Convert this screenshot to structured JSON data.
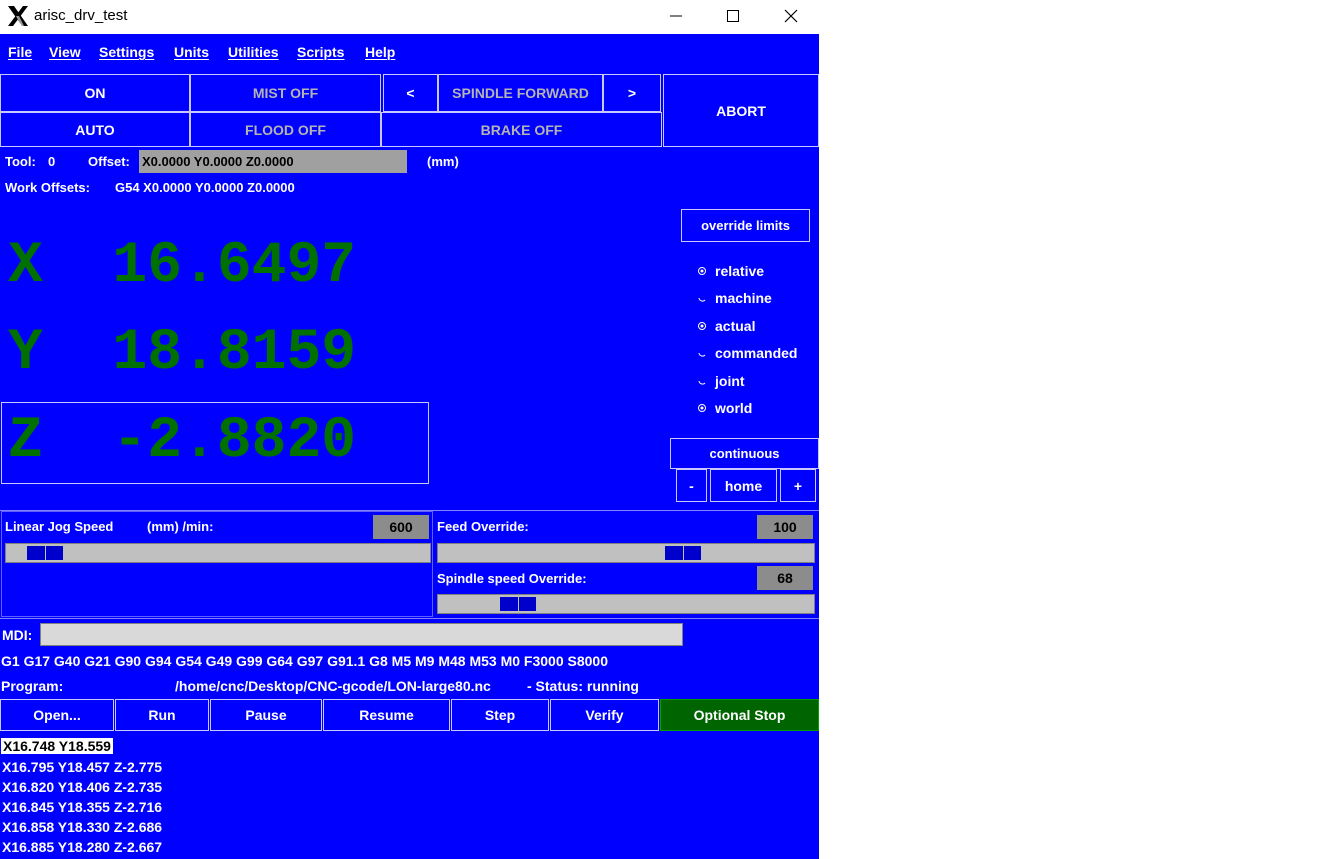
{
  "window": {
    "title": "arisc_drv_test",
    "controls": [
      "minimize-icon",
      "maximize-icon",
      "close-icon"
    ]
  },
  "menubar": {
    "items": [
      "File",
      "View",
      "Settings",
      "Units",
      "Utilities",
      "Scripts",
      "Help"
    ]
  },
  "toolbar": {
    "on": "ON",
    "mist": "MIST OFF",
    "spindle_down": "<",
    "spindle": "SPINDLE FORWARD",
    "spindle_up": ">",
    "abort": "ABORT",
    "auto": "AUTO",
    "flood": "FLOOD OFF",
    "brake": "BRAKE OFF"
  },
  "status": {
    "tool_label": "Tool:",
    "tool_value": "0",
    "offset_label": "Offset:",
    "offset_value": "X0.0000 Y0.0000 Z0.0000",
    "units": "(mm)",
    "work_offsets_label": "Work Offsets:",
    "work_offsets_value": "G54 X0.0000 Y0.0000 Z0.0000"
  },
  "dro": {
    "x": "X  16.6497",
    "y": "Y  18.8159",
    "z": "Z  -2.8820",
    "active_axis": "Z"
  },
  "side": {
    "override_limits": "override limits",
    "radios": [
      {
        "label": "relative",
        "checked": true
      },
      {
        "label": "machine",
        "checked": false
      },
      {
        "label": "actual",
        "checked": true
      },
      {
        "label": "commanded",
        "checked": false
      },
      {
        "label": "joint",
        "checked": false
      },
      {
        "label": "world",
        "checked": true
      }
    ],
    "jog_mode": "continuous",
    "jog_minus": "-",
    "home": "home",
    "jog_plus": "+"
  },
  "sliders": {
    "jog_label": "Linear Jog Speed",
    "jog_units": "(mm) /min:",
    "jog_value": "600",
    "feed_label": "Feed Override:",
    "feed_value": "100",
    "spindle_label": "Spindle speed Override:",
    "spindle_value": "68"
  },
  "mdi": {
    "label": "MDI:",
    "value": "",
    "gcodes": "G1 G17 G40 G21 G90 G94 G54 G49 G99 G64 G97 G91.1 G8 M5 M9 M48 M53 M0 F3000 S8000"
  },
  "program": {
    "label": "Program:",
    "path": "/home/cnc/Desktop/CNC-gcode/LON-large80.nc",
    "status_text": "-  Status:  running"
  },
  "program_buttons": [
    "Open...",
    "Run",
    "Pause",
    "Resume",
    "Step",
    "Verify",
    "Optional Stop"
  ],
  "colors": {
    "background": "#0000ff",
    "dro_text": "#007000",
    "optional_stop": "#006400",
    "field_gray": "#a0a0a0"
  },
  "code_lines": [
    "X16.748 Y18.559",
    "X16.795 Y18.457 Z-2.775",
    "X16.820 Y18.406 Z-2.735",
    "X16.845 Y18.355 Z-2.716",
    "X16.858 Y18.330 Z-2.686",
    "X16.885 Y18.280 Z-2.667"
  ]
}
